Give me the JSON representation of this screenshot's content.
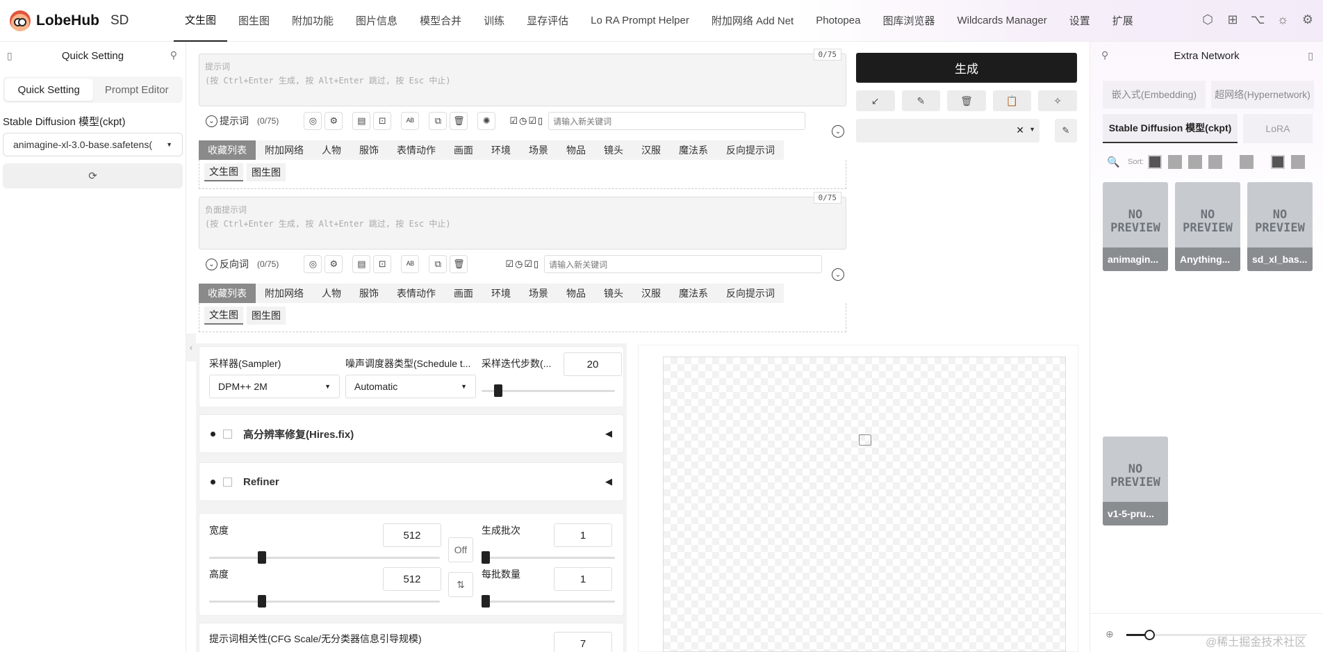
{
  "header": {
    "brand": "LobeHub",
    "app": "SD",
    "tabs": [
      "文生图",
      "图生图",
      "附加功能",
      "图片信息",
      "模型合并",
      "训练",
      "显存评估",
      "Lo RA Prompt Helper",
      "附加网络 Add Net",
      "Photopea",
      "图库浏览器",
      "Wildcards Manager",
      "设置",
      "扩展"
    ],
    "icons": [
      "lobehub-icon",
      "grid-icon",
      "github-icon",
      "sun-icon",
      "gear-icon"
    ]
  },
  "left": {
    "title": "Quick Setting",
    "seg": [
      "Quick Setting",
      "Prompt Editor"
    ],
    "model_label": "Stable Diffusion 模型(ckpt)",
    "model_value": "animagine-xl-3.0-base.safetens("
  },
  "prompt": {
    "placeholder1": "提示词",
    "placeholder2": "(按 Ctrl+Enter 生成, 按 Alt+Enter 跳过, 按 Esc 中止)",
    "count_badge": "0/75",
    "label": "提示词",
    "count": "(0/75)",
    "keyword_placeholder": "请输入新关键词"
  },
  "neg": {
    "placeholder1": "负面提示词",
    "placeholder2": "(按 Ctrl+Enter 生成, 按 Alt+Enter 跳过, 按 Esc 中止)",
    "count_badge": "0/75",
    "label": "反向词",
    "count": "(0/75)",
    "keyword_placeholder": "请输入新关键词"
  },
  "categories": [
    "收藏列表",
    "附加网络",
    "人物",
    "服饰",
    "表情动作",
    "画面",
    "环境",
    "场景",
    "物品",
    "镜头",
    "汉服",
    "魔法系",
    "反向提示词"
  ],
  "subtabs": [
    "文生图",
    "图生图"
  ],
  "generate": {
    "label": "生成"
  },
  "params": {
    "sampler_label": "采样器(Sampler)",
    "sampler": "DPM++ 2M",
    "schedule_label": "噪声调度器类型(Schedule t...",
    "schedule": "Automatic",
    "steps_label": "采样迭代步数(...",
    "steps": "20",
    "steps_frac": 0.125,
    "hires": "高分辨率修复(Hires.fix)",
    "refiner": "Refiner",
    "width_label": "宽度",
    "width": "512",
    "width_frac": 0.23,
    "height_label": "高度",
    "height": "512",
    "height_frac": 0.23,
    "off_label": "Off",
    "swap_icon": "swap-icon",
    "batch_count_label": "生成批次",
    "batch_count": "1",
    "batch_size_label": "每批数量",
    "batch_size": "1",
    "cfg_label": "提示词相关性(CFG Scale/无分类器信息引导规模)",
    "cfg": "7"
  },
  "right": {
    "title": "Extra Network",
    "tabs1": [
      "嵌入式(Embedding)",
      "超网络(Hypernetwork)"
    ],
    "tabs2": [
      "Stable Diffusion 模型(ckpt)",
      "LoRA"
    ],
    "sort_label": "Sort:",
    "cards": [
      {
        "name": "animagin...",
        "preview": "NO PREVIEW"
      },
      {
        "name": "Anything...",
        "preview": "NO PREVIEW"
      },
      {
        "name": "sd_xl_bas...",
        "preview": "NO PREVIEW"
      },
      {
        "name": "v1-5-pru...",
        "preview": "NO PREVIEW"
      }
    ]
  },
  "watermark": "@稀土掘金技术社区"
}
